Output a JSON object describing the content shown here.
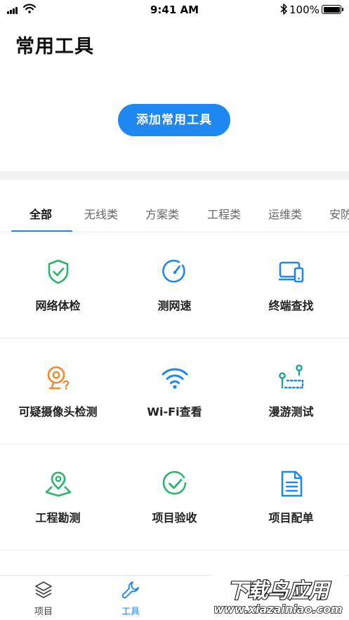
{
  "status_bar": {
    "time": "9:41 AM",
    "battery": "100%"
  },
  "header": {
    "title": "常用工具"
  },
  "add_button": {
    "label": "添加常用工具"
  },
  "tabs": [
    {
      "label": "全部"
    },
    {
      "label": "无线类"
    },
    {
      "label": "方案类"
    },
    {
      "label": "工程类"
    },
    {
      "label": "运维类"
    },
    {
      "label": "安防"
    }
  ],
  "tools": [
    {
      "label": "网络体检",
      "icon": "shield-check-icon",
      "color": "#2db36b"
    },
    {
      "label": "测网速",
      "icon": "speedometer-icon",
      "color": "#1e88f0"
    },
    {
      "label": "终端查找",
      "icon": "devices-icon",
      "color": "#1e88f0"
    },
    {
      "label": "可疑摄像头检测",
      "icon": "webcam-question-icon",
      "color": "#f08a2c"
    },
    {
      "label": "Wi-Fi查看",
      "icon": "wifi-icon",
      "color": "#1e88f0"
    },
    {
      "label": "漫游测试",
      "icon": "roaming-path-icon",
      "color": "#1aa39b"
    },
    {
      "label": "工程勘测",
      "icon": "map-pin-icon",
      "color": "#2db36b"
    },
    {
      "label": "项目验收",
      "icon": "check-circle-icon",
      "color": "#2db36b"
    },
    {
      "label": "项目配单",
      "icon": "document-icon",
      "color": "#1e88f0"
    }
  ],
  "bottom_nav": [
    {
      "label": "项目",
      "icon": "layers-icon"
    },
    {
      "label": "工具",
      "icon": "wrench-icon"
    }
  ],
  "watermark": {
    "text": "下载鸟应用",
    "url_text": "www.xiazainiao.com"
  },
  "colors": {
    "accent": "#1e88f0",
    "green": "#2db36b",
    "orange": "#f08a2c",
    "teal": "#1aa39b"
  }
}
